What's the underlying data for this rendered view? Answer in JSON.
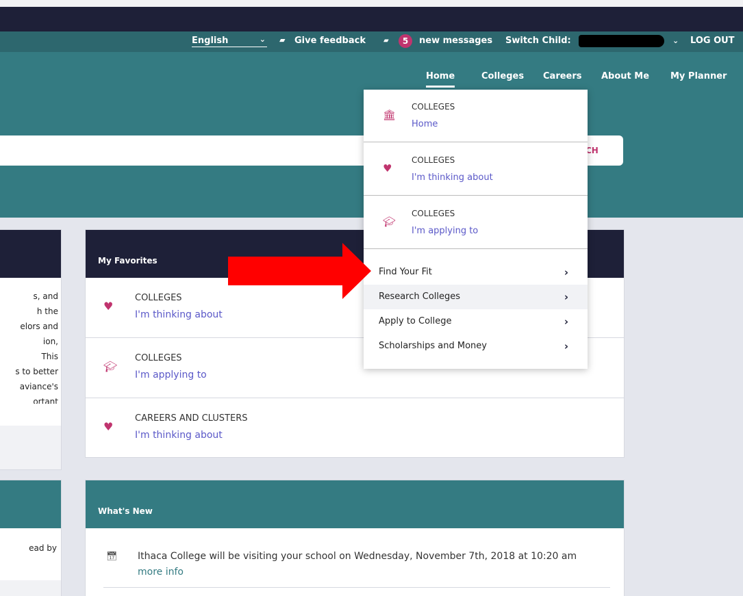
{
  "topbar": {
    "language": "English",
    "feedback": "Give feedback",
    "message_count": "5",
    "messages_label": "new messages",
    "switch_child": "Switch Child:",
    "logout": "LOG OUT"
  },
  "nav": {
    "items": [
      "Home",
      "Colleges",
      "Careers",
      "About Me",
      "My Planner"
    ],
    "active": "Home"
  },
  "search": {
    "button_partial": "CH"
  },
  "dropdown": {
    "sections": [
      {
        "category": "COLLEGES",
        "label": "Home",
        "icon": "building-icon"
      },
      {
        "category": "COLLEGES",
        "label": "I'm thinking about",
        "icon": "heart-icon"
      },
      {
        "category": "COLLEGES",
        "label": "I'm applying to",
        "icon": "graduation-cap-icon"
      }
    ],
    "links": [
      "Find Your Fit",
      "Research Colleges",
      "Apply to College",
      "Scholarships and Money"
    ],
    "highlighted": "Research Colleges"
  },
  "favorites": {
    "title": "My Favorites",
    "items": [
      {
        "category": "COLLEGES",
        "label": "I'm thinking about",
        "icon": "heart-icon"
      },
      {
        "category": "COLLEGES",
        "label": "I'm applying to",
        "icon": "graduation-cap-icon"
      },
      {
        "category": "CAREERS AND CLUSTERS",
        "label": "I'm thinking about",
        "icon": "heart-icon"
      }
    ]
  },
  "left_panel": {
    "lines": [
      "s, and",
      "h the",
      "elors and",
      "ion,",
      "This",
      "s to better",
      "aviance's",
      "ortant"
    ],
    "second_text": "ead by"
  },
  "whats_new": {
    "title": "What's New",
    "item_text": "Ithaca College will be visiting your school on Wednesday, November 7th, 2018 at 10:20 am",
    "item_link": "more info"
  },
  "colors": {
    "navy": "#1e2038",
    "teal": "#347b82",
    "magenta": "#c0346e",
    "link": "#5a58c8",
    "arrow": "#ff0000"
  }
}
